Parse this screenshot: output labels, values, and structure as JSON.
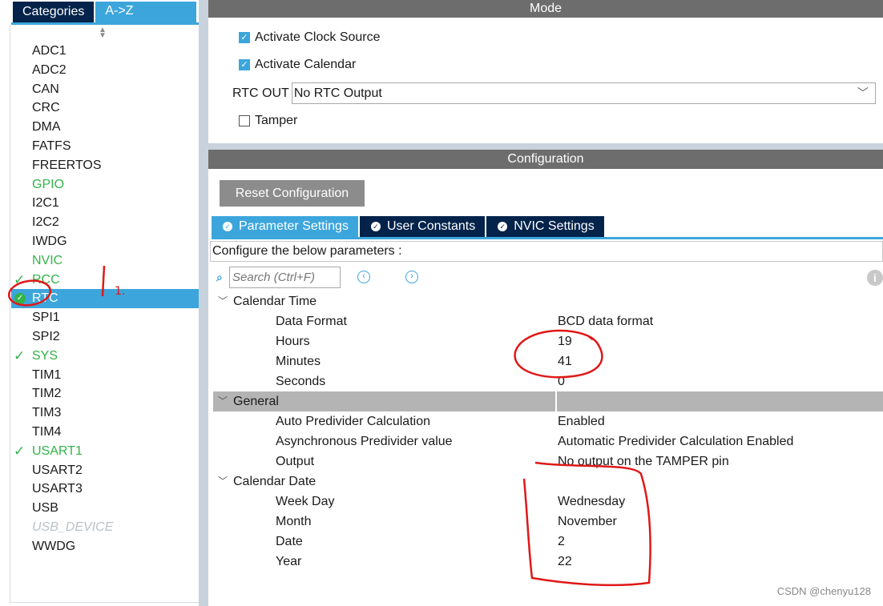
{
  "left_tabs": {
    "categories": "Categories",
    "az": "A->Z"
  },
  "peripherals": [
    {
      "label": "ADC1",
      "state": "normal"
    },
    {
      "label": "ADC2",
      "state": "normal"
    },
    {
      "label": "CAN",
      "state": "normal"
    },
    {
      "label": "CRC",
      "state": "normal"
    },
    {
      "label": "DMA",
      "state": "normal"
    },
    {
      "label": "FATFS",
      "state": "normal"
    },
    {
      "label": "FREERTOS",
      "state": "normal"
    },
    {
      "label": "GPIO",
      "state": "green"
    },
    {
      "label": "I2C1",
      "state": "normal"
    },
    {
      "label": "I2C2",
      "state": "normal"
    },
    {
      "label": "IWDG",
      "state": "normal"
    },
    {
      "label": "NVIC",
      "state": "green"
    },
    {
      "label": "RCC",
      "state": "green-check"
    },
    {
      "label": "RTC",
      "state": "selected"
    },
    {
      "label": "SPI1",
      "state": "normal"
    },
    {
      "label": "SPI2",
      "state": "normal"
    },
    {
      "label": "SYS",
      "state": "green-check"
    },
    {
      "label": "TIM1",
      "state": "normal"
    },
    {
      "label": "TIM2",
      "state": "normal"
    },
    {
      "label": "TIM3",
      "state": "normal"
    },
    {
      "label": "TIM4",
      "state": "normal"
    },
    {
      "label": "USART1",
      "state": "green-check"
    },
    {
      "label": "USART2",
      "state": "normal"
    },
    {
      "label": "USART3",
      "state": "normal"
    },
    {
      "label": "USB",
      "state": "normal"
    },
    {
      "label": "USB_DEVICE",
      "state": "disabled"
    },
    {
      "label": "WWDG",
      "state": "normal"
    }
  ],
  "mode": {
    "title": "Mode",
    "activate_clock": "Activate Clock Source",
    "activate_calendar": "Activate Calendar",
    "rtc_out_label": "RTC OUT",
    "rtc_out_value": "No RTC Output",
    "tamper": "Tamper"
  },
  "config": {
    "title": "Configuration",
    "reset_button": "Reset Configuration",
    "tabs": [
      "Parameter Settings",
      "User Constants",
      "NVIC Settings"
    ],
    "configure_text": "Configure the below parameters :",
    "search_placeholder": "Search (Ctrl+F)"
  },
  "params": {
    "calendar_time": {
      "title": "Calendar Time",
      "rows": [
        {
          "name": "Data Format",
          "value": "BCD data format"
        },
        {
          "name": "Hours",
          "value": "19"
        },
        {
          "name": "Minutes",
          "value": "41"
        },
        {
          "name": "Seconds",
          "value": "0"
        }
      ]
    },
    "general": {
      "title": "General",
      "rows": [
        {
          "name": "Auto Predivider Calculation",
          "value": "Enabled"
        },
        {
          "name": "Asynchronous Predivider value",
          "value": "Automatic Predivider Calculation Enabled"
        },
        {
          "name": "Output",
          "value": "No output on the TAMPER pin"
        }
      ]
    },
    "calendar_date": {
      "title": "Calendar Date",
      "rows": [
        {
          "name": "Week Day",
          "value": "Wednesday"
        },
        {
          "name": "Month",
          "value": "November"
        },
        {
          "name": "Date",
          "value": "2"
        },
        {
          "name": "Year",
          "value": "22"
        }
      ]
    }
  },
  "annotation": {
    "mark": "1."
  },
  "watermark": "CSDN @chenyu128",
  "colors": {
    "accent": "#3ca6dc",
    "navy": "#03234b",
    "green": "#33b34a",
    "annotation_red": "#e01818"
  }
}
